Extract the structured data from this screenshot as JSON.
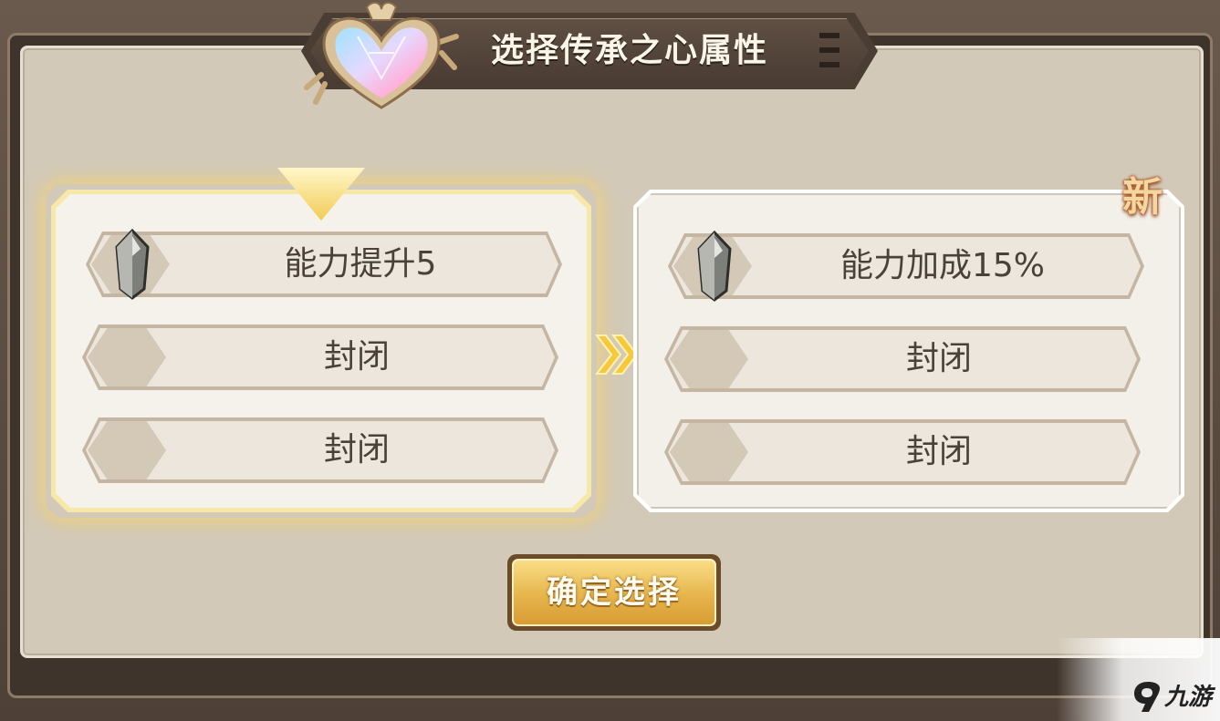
{
  "title": "选择传承之心属性",
  "current_card": {
    "slots": [
      {
        "label": "能力提升5",
        "has_gem": true
      },
      {
        "label": "封闭",
        "has_gem": false
      },
      {
        "label": "封闭",
        "has_gem": false
      }
    ]
  },
  "new_card": {
    "badge": "新",
    "slots": [
      {
        "label": "能力加成15%",
        "has_gem": true
      },
      {
        "label": "封闭",
        "has_gem": false
      },
      {
        "label": "封闭",
        "has_gem": false
      }
    ]
  },
  "confirm_label": "确定选择",
  "watermark": {
    "text": "九游",
    "logo_icon": "9-logo-icon"
  },
  "colors": {
    "panel": "#d2c9b8",
    "selected_glow": "#f1cb55",
    "button": "#e6b54c",
    "title_bar": "#4a3d34"
  }
}
